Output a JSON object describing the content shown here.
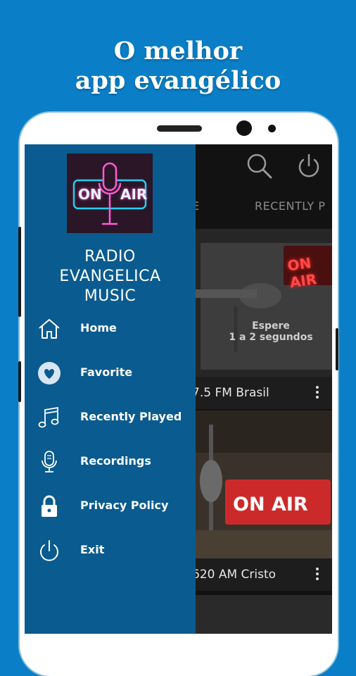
{
  "headline": {
    "line1": "O melhor",
    "line2": "app evangélico"
  },
  "appbar": {
    "search_icon": "search-icon",
    "power_icon": "power-icon"
  },
  "tabs": [
    {
      "label": "E"
    },
    {
      "label": "RECENTLY P"
    }
  ],
  "cards": [
    {
      "title": "7.5 FM Brasil",
      "image_text": [
        "Espere",
        "1 a 2 segundos"
      ],
      "sign": "ON AIR"
    },
    {
      "title": "620 AM Cristo",
      "sign": "ON AIR"
    }
  ],
  "drawer": {
    "logo": {
      "text_left": "ON",
      "text_right": "AIR"
    },
    "app_name": [
      "RADIO",
      "EVANGELICA",
      "MUSIC"
    ],
    "menu": [
      {
        "label": "Home",
        "icon": "home-icon"
      },
      {
        "label": "Favorite",
        "icon": "heart-icon"
      },
      {
        "label": "Recently Played",
        "icon": "music-note-icon"
      },
      {
        "label": "Recordings",
        "icon": "microphone-icon"
      },
      {
        "label": "Privacy Policy",
        "icon": "lock-icon"
      },
      {
        "label": "Exit",
        "icon": "power-icon"
      }
    ]
  },
  "colors": {
    "background": "#0a7fc7",
    "drawer": "#0a5b8f",
    "screen": "#121212"
  }
}
